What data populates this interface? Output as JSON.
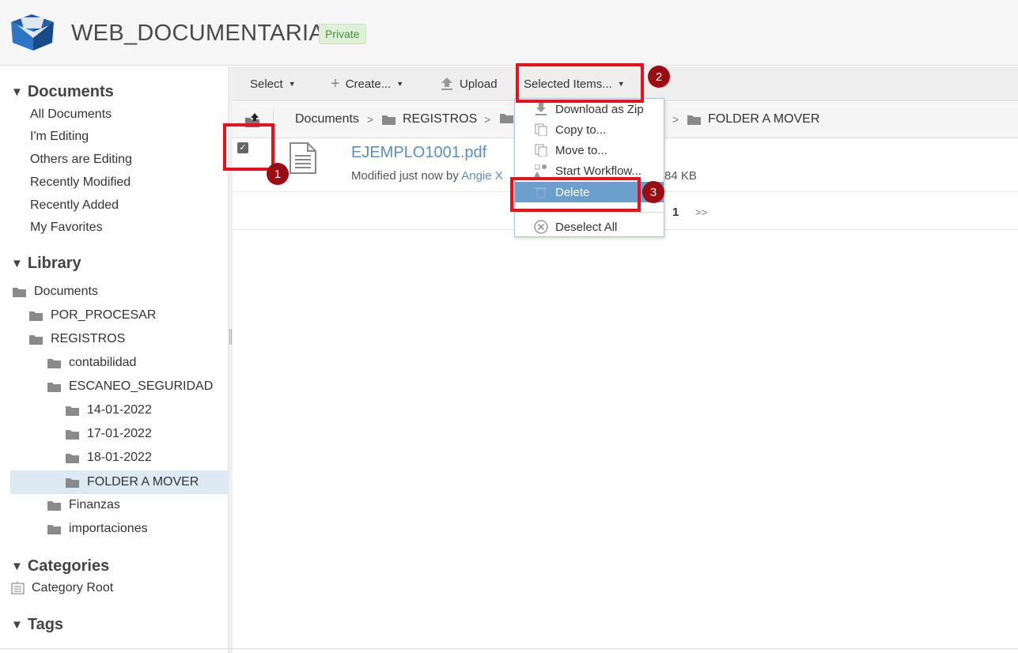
{
  "header": {
    "site_title": "WEB_DOCUMENTARIA",
    "visibility_badge": "Private"
  },
  "sidebar": {
    "documents_heading": "Documents",
    "filters": [
      "All Documents",
      "I'm Editing",
      "Others are Editing",
      "Recently Modified",
      "Recently Added",
      "My Favorites"
    ],
    "library_heading": "Library",
    "tree": [
      "Documents",
      "POR_PROCESAR",
      "REGISTROS",
      "contabilidad",
      "ESCANEO_SEGURIDAD",
      "14-01-2022",
      "17-01-2022",
      "18-01-2022",
      "FOLDER A MOVER",
      "Finanzas",
      "importaciones"
    ],
    "categories_heading": "Categories",
    "category_root": "Category Root",
    "tags_heading": "Tags"
  },
  "toolbar": {
    "select_label": "Select",
    "create_label": "Create...",
    "upload_label": "Upload",
    "selected_items_label": "Selected Items..."
  },
  "breadcrumb": {
    "part1": "Documents",
    "part2": "REGISTROS",
    "current": "FOLDER A MOVER",
    "separator": ">"
  },
  "document": {
    "title": "EJEMPLO1001.pdf",
    "meta_prefix": "Modified just now by",
    "user": "Angie X",
    "size": "84 KB",
    "checked": true
  },
  "pager": {
    "current_page": "1",
    "next": ">>"
  },
  "dropdown": {
    "items": [
      "Download as Zip",
      "Copy to...",
      "Move to...",
      "Start Workflow...",
      "Delete",
      "Deselect All"
    ]
  },
  "annotations": [
    "1",
    "2",
    "3"
  ],
  "colors": {
    "link": "#5a8fc0",
    "highlight": "#6d9fcc",
    "annotation_border": "#e8101a",
    "annotation_badge": "#9b0d12",
    "badge_green": "#dff0d8"
  }
}
